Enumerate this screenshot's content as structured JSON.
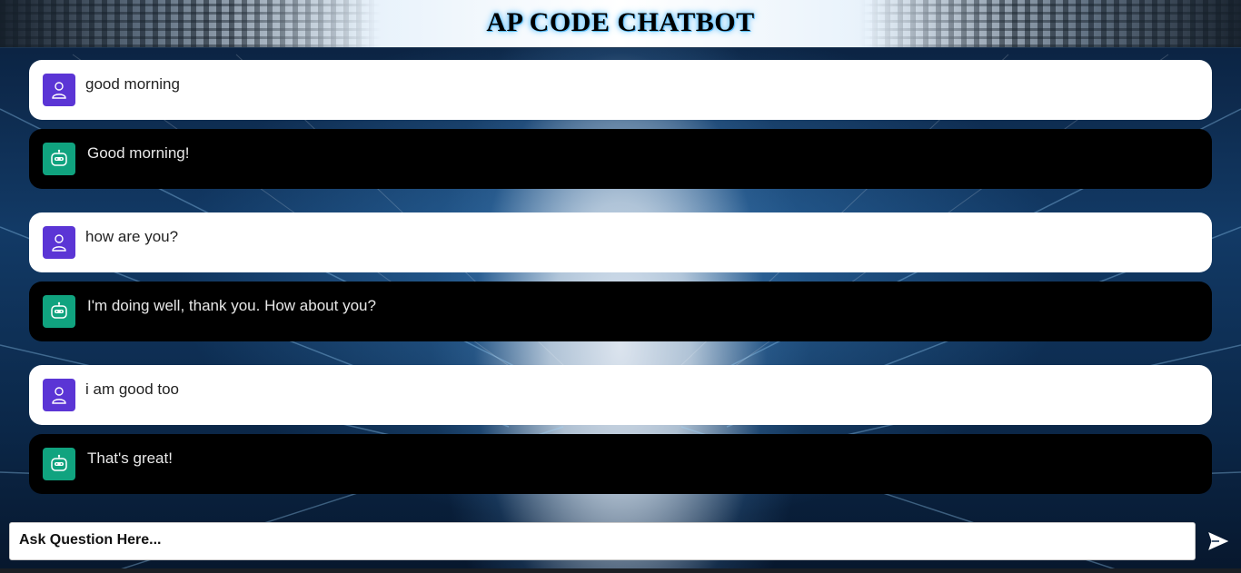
{
  "header": {
    "title": "AP CODE CHATBOT"
  },
  "messages": [
    {
      "role": "user",
      "text": "good morning"
    },
    {
      "role": "bot",
      "text": "Good morning!"
    },
    {
      "role": "user",
      "text": "how are you?"
    },
    {
      "role": "bot",
      "text": "I'm doing well, thank you. How about you?"
    },
    {
      "role": "user",
      "text": "i am good too"
    },
    {
      "role": "bot",
      "text": "That's great!"
    }
  ],
  "composer": {
    "placeholder": "Ask Question Here...",
    "value": ""
  },
  "icons": {
    "user_avatar": "user-icon",
    "bot_avatar": "robot-icon",
    "send": "send-icon"
  },
  "colors": {
    "user_avatar_bg": "#5b35d5",
    "bot_avatar_bg": "#10a37f",
    "user_bubble_bg": "#ffffff",
    "bot_bubble_bg": "#000000"
  }
}
